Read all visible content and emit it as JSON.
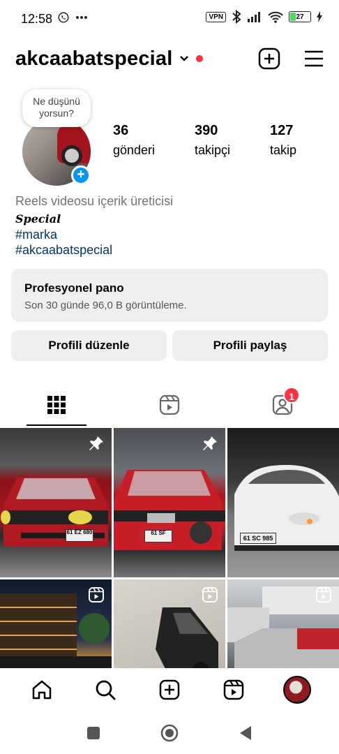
{
  "status_bar": {
    "time": "12:58",
    "battery_level": "27",
    "battery_percent": 27,
    "vpn_label": "VPN",
    "icons": [
      "whatsapp-icon",
      "more-icon",
      "vpn-icon",
      "bluetooth-icon",
      "signal-icon",
      "wifi-icon",
      "battery-icon",
      "charging-icon"
    ]
  },
  "header": {
    "username": "akcaabatspecial",
    "has_notification_dot": true
  },
  "profile": {
    "note_bubble": "Ne düşünü yorsun?",
    "stats": [
      {
        "value": "36",
        "label": "gönderi"
      },
      {
        "value": "390",
        "label": "takipçi"
      },
      {
        "value": "127",
        "label": "takip"
      }
    ],
    "category": "Reels videosu içerik üreticisi",
    "bio_script": "Special",
    "hashtags": [
      "#marka",
      "#akcaabatspecial"
    ]
  },
  "dashboard": {
    "title": "Profesyonel pano",
    "subtitle": "Son 30 günde 96,0 B görüntüleme."
  },
  "buttons": {
    "edit_profile": "Profili düzenle",
    "share_profile": "Profili paylaş"
  },
  "tabs": {
    "items": [
      "grid-icon",
      "reels-icon",
      "tagged-icon"
    ],
    "tagged_badge": "1"
  },
  "posts": [
    {
      "type": "pinned",
      "plate": "61 EZ 680"
    },
    {
      "type": "pinned",
      "plate": "61 SF"
    },
    {
      "type": "photo",
      "plate": "61 SC 985"
    },
    {
      "type": "reel"
    },
    {
      "type": "reel"
    },
    {
      "type": "reel"
    }
  ],
  "colors": {
    "accent_blue": "#0095f6",
    "link_blue": "#00376b",
    "notification_red": "#ff3040",
    "button_bg": "#efefef"
  }
}
